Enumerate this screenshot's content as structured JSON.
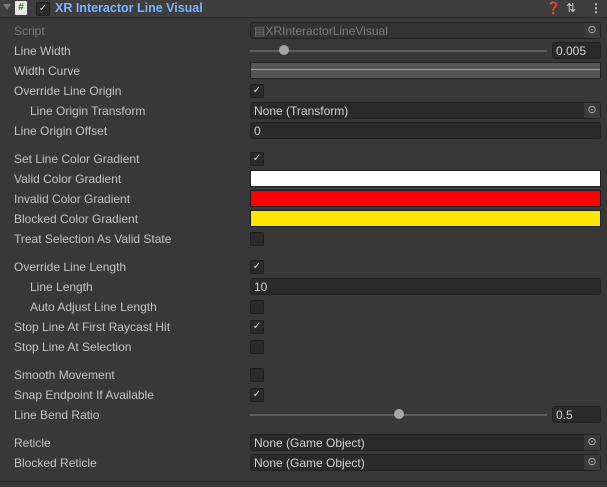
{
  "header": {
    "title": "XR Interactor Line Visual",
    "enabled": true,
    "help_icon": "help-icon",
    "presets_icon": "presets-icon",
    "menu_icon": "kebab-menu-icon"
  },
  "rows": [
    {
      "label": "Script",
      "type": "object",
      "value": "XRInteractorLineVisual",
      "dim": true
    },
    {
      "label": "Line Width",
      "type": "slider",
      "value": "0.005",
      "fraction": 0.115
    },
    {
      "label": "Width Curve",
      "type": "curve",
      "color": "#3ee83e"
    },
    {
      "label": "Override Line Origin",
      "type": "check",
      "checked": true
    },
    {
      "label": "Line Origin Transform",
      "type": "object",
      "value": "None (Transform)",
      "indent": true
    },
    {
      "label": "Line Origin Offset",
      "type": "text",
      "value": "0"
    },
    {
      "label": "Set Line Color Gradient",
      "type": "check",
      "checked": true,
      "gap": true
    },
    {
      "label": "Valid Color Gradient",
      "type": "color",
      "color": "#ffffff"
    },
    {
      "label": "Invalid Color Gradient",
      "type": "color",
      "color": "#ff0000"
    },
    {
      "label": "Blocked Color Gradient",
      "type": "color",
      "color": "#ffe600"
    },
    {
      "label": "Treat Selection As Valid State",
      "type": "check",
      "checked": false
    },
    {
      "label": "Override Line Length",
      "type": "check",
      "checked": true,
      "gap": true
    },
    {
      "label": "Line Length",
      "type": "text",
      "value": "10",
      "indent": true
    },
    {
      "label": "Auto Adjust Line Length",
      "type": "check",
      "checked": false,
      "indent": true
    },
    {
      "label": "Stop Line At First Raycast Hit",
      "type": "check",
      "checked": true
    },
    {
      "label": "Stop Line At Selection",
      "type": "check",
      "checked": false
    },
    {
      "label": "Smooth Movement",
      "type": "check",
      "checked": false,
      "gap": true
    },
    {
      "label": "Snap Endpoint If Available",
      "type": "check",
      "checked": true
    },
    {
      "label": "Line Bend Ratio",
      "type": "slider",
      "value": "0.5",
      "fraction": 0.5
    },
    {
      "label": "Reticle",
      "type": "object",
      "value": "None (Game Object)",
      "gap": true
    },
    {
      "label": "Blocked Reticle",
      "type": "object",
      "value": "None (Game Object)"
    }
  ]
}
